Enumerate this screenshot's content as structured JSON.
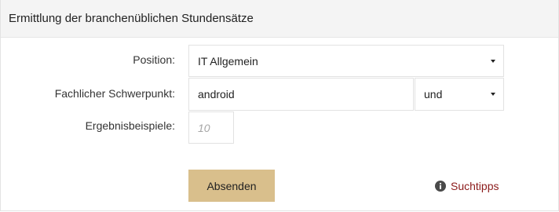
{
  "panel": {
    "title": "Ermittlung der branchenüblichen Stundensätze"
  },
  "form": {
    "position": {
      "label": "Position:",
      "selected": "IT Allgemein"
    },
    "focus": {
      "label": "Fachlicher Schwerpunkt:",
      "value": "android",
      "operator_selected": "und"
    },
    "results": {
      "label": "Ergebnisbeispiele:",
      "placeholder": "10"
    },
    "submit_label": "Absenden",
    "tips_label": "Suchtipps"
  },
  "icons": {
    "dropdown": "chevron-down-icon",
    "tips": "info-icon"
  },
  "colors": {
    "header_bg": "#f4f4f4",
    "button_bg": "#d9bf8c",
    "link": "#8b1a1a"
  }
}
